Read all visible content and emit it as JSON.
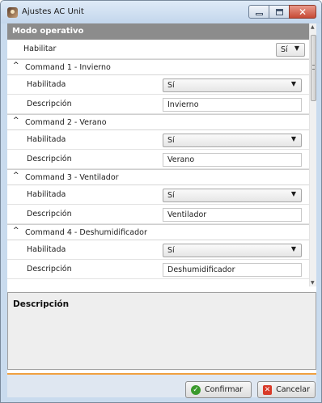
{
  "window": {
    "title": "Ajustes AC Unit",
    "controls": {
      "minimize": "—",
      "maximize": "▢",
      "close": "✕"
    }
  },
  "modo": {
    "header": "Modo operativo",
    "habilitar_label": "Habilitar",
    "habilitar_value": "Sí"
  },
  "commands": [
    {
      "title": "Command 1 - Invierno",
      "habilitada_label": "Habilitada",
      "habilitada_value": "Sí",
      "descripcion_label": "Descripción",
      "descripcion_value": "Invierno"
    },
    {
      "title": "Command 2 - Verano",
      "habilitada_label": "Habilitada",
      "habilitada_value": "Sí",
      "descripcion_label": "Descripción",
      "descripcion_value": "Verano"
    },
    {
      "title": "Command 3 - Ventilador",
      "habilitada_label": "Habilitada",
      "habilitada_value": "Sí",
      "descripcion_label": "Descripción",
      "descripcion_value": "Ventilador"
    },
    {
      "title": "Command 4 - Deshumidificador",
      "habilitada_label": "Habilitada",
      "habilitada_value": "Sí",
      "descripcion_label": "Descripción",
      "descripcion_value": "Deshumidificador"
    }
  ],
  "description_pane": {
    "title": "Descripción"
  },
  "buttons": {
    "confirm": "Confirmar",
    "cancel": "Cancelar"
  },
  "icons": {
    "caret": "^",
    "dropdown_arrow": "▼",
    "confirm_icon": "check-circle-green",
    "cancel_icon": "close-square-red"
  },
  "colors": {
    "header_bg": "#8c8c8c",
    "accent_line": "#f0a040",
    "confirm_icon": "#3a9a2c",
    "cancel_icon": "#d83a28"
  }
}
